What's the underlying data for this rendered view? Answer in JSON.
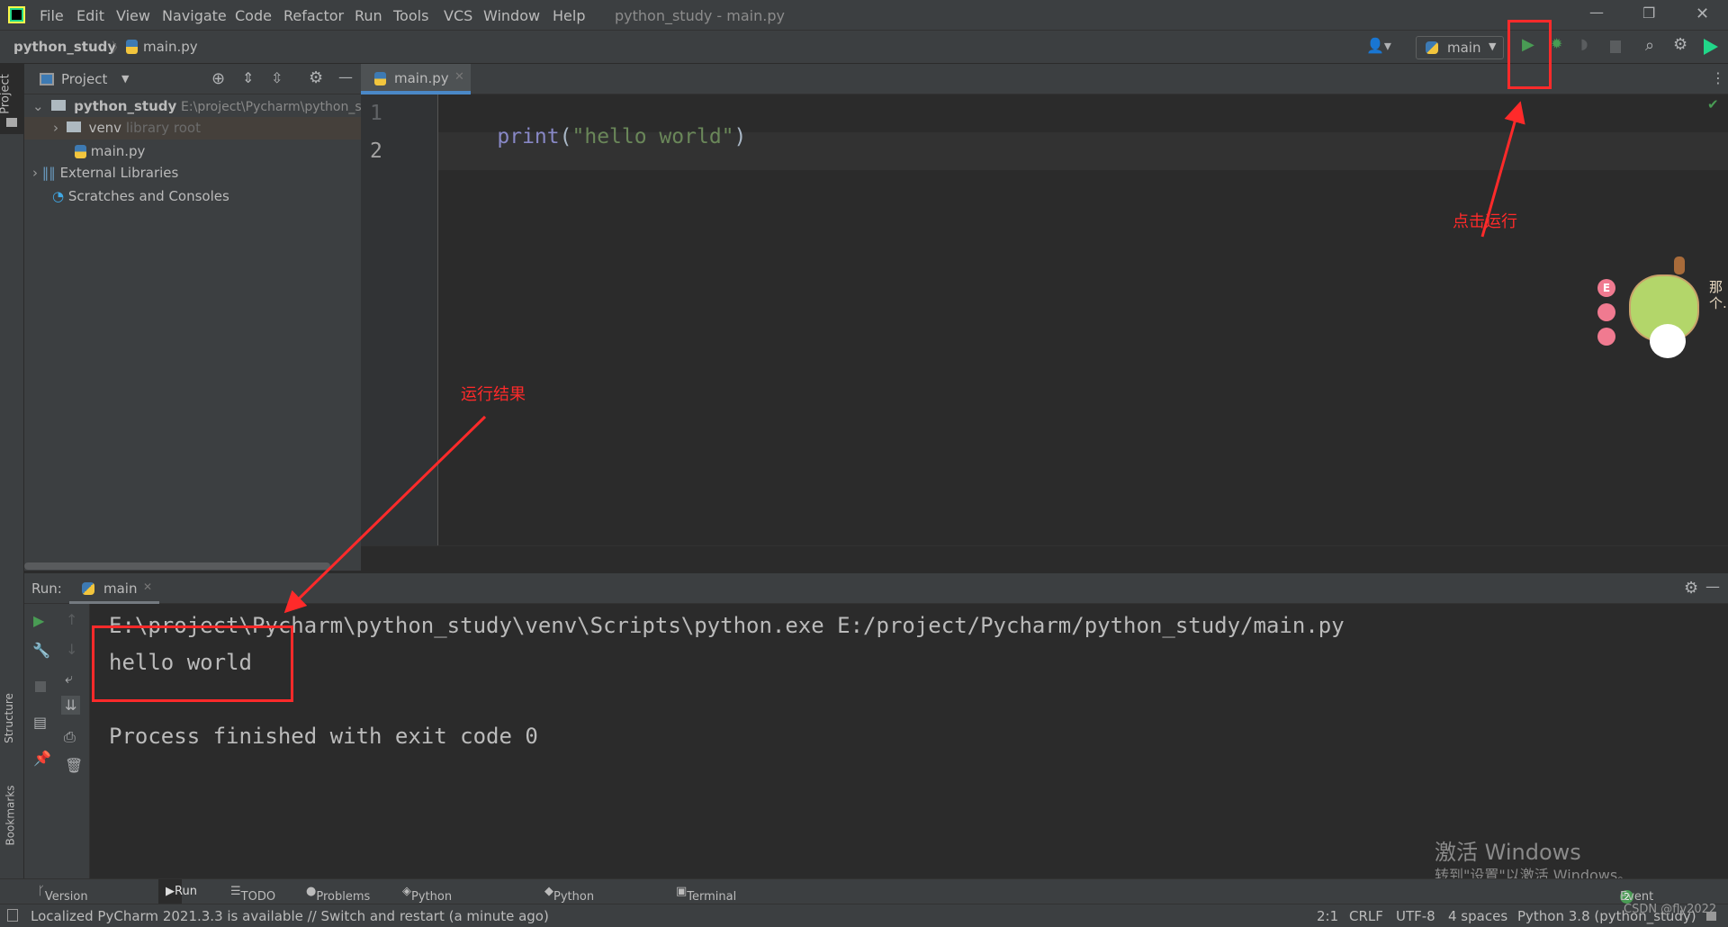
{
  "window": {
    "title": "python_study - main.py",
    "menu": [
      "File",
      "Edit",
      "View",
      "Navigate",
      "Code",
      "Refactor",
      "Run",
      "Tools",
      "VCS",
      "Window",
      "Help"
    ]
  },
  "breadcrumb": {
    "project": "python_study",
    "file": "main.py"
  },
  "toolbar": {
    "run_config": "main"
  },
  "project_panel": {
    "title": "Project",
    "stripe_label": "Project",
    "tree": [
      {
        "label": "python_study",
        "hint": "E:\\project\\Pycharm\\python_s"
      },
      {
        "label": "venv",
        "hint": "library root"
      },
      {
        "label": "main.py"
      },
      {
        "label": "External Libraries"
      },
      {
        "label": "Scratches and Consoles"
      }
    ]
  },
  "editor": {
    "tab": "main.py",
    "line_numbers": [
      "1",
      "2"
    ],
    "code": {
      "func": "print",
      "open": "(",
      "string": "\"hello world\"",
      "close": ")"
    }
  },
  "run": {
    "label": "Run:",
    "tab": "main",
    "output": [
      "E:\\project\\Pycharm\\python_study\\venv\\Scripts\\python.exe E:/project/Pycharm/python_study/main.py",
      "hello world",
      "",
      "Process finished with exit code 0"
    ]
  },
  "left_stripe": {
    "structure": "Structure",
    "bookmarks": "Bookmarks"
  },
  "bottom_tools": [
    "Version Control",
    "Run",
    "TODO",
    "Problems",
    "Python Packages",
    "Python Console",
    "Terminal"
  ],
  "event_log": {
    "label": "Event Log",
    "count": "2"
  },
  "status": {
    "message": "Localized PyCharm 2021.3.3 is available // Switch and restart (a minute ago)",
    "position": "2:1",
    "line_sep": "CRLF",
    "encoding": "UTF-8",
    "indent": "4 spaces",
    "interpreter": "Python 3.8 (python_study)"
  },
  "annotations": {
    "run_hint": "点击运行",
    "result_hint": "运行结果",
    "color": "#ff2a2a"
  },
  "watermark": {
    "line1": "激活 Windows",
    "line2": "转到\"设置\"以激活 Windows。",
    "csdn": "CSDN @fly2022"
  },
  "sticker": {
    "text": "那个..."
  }
}
